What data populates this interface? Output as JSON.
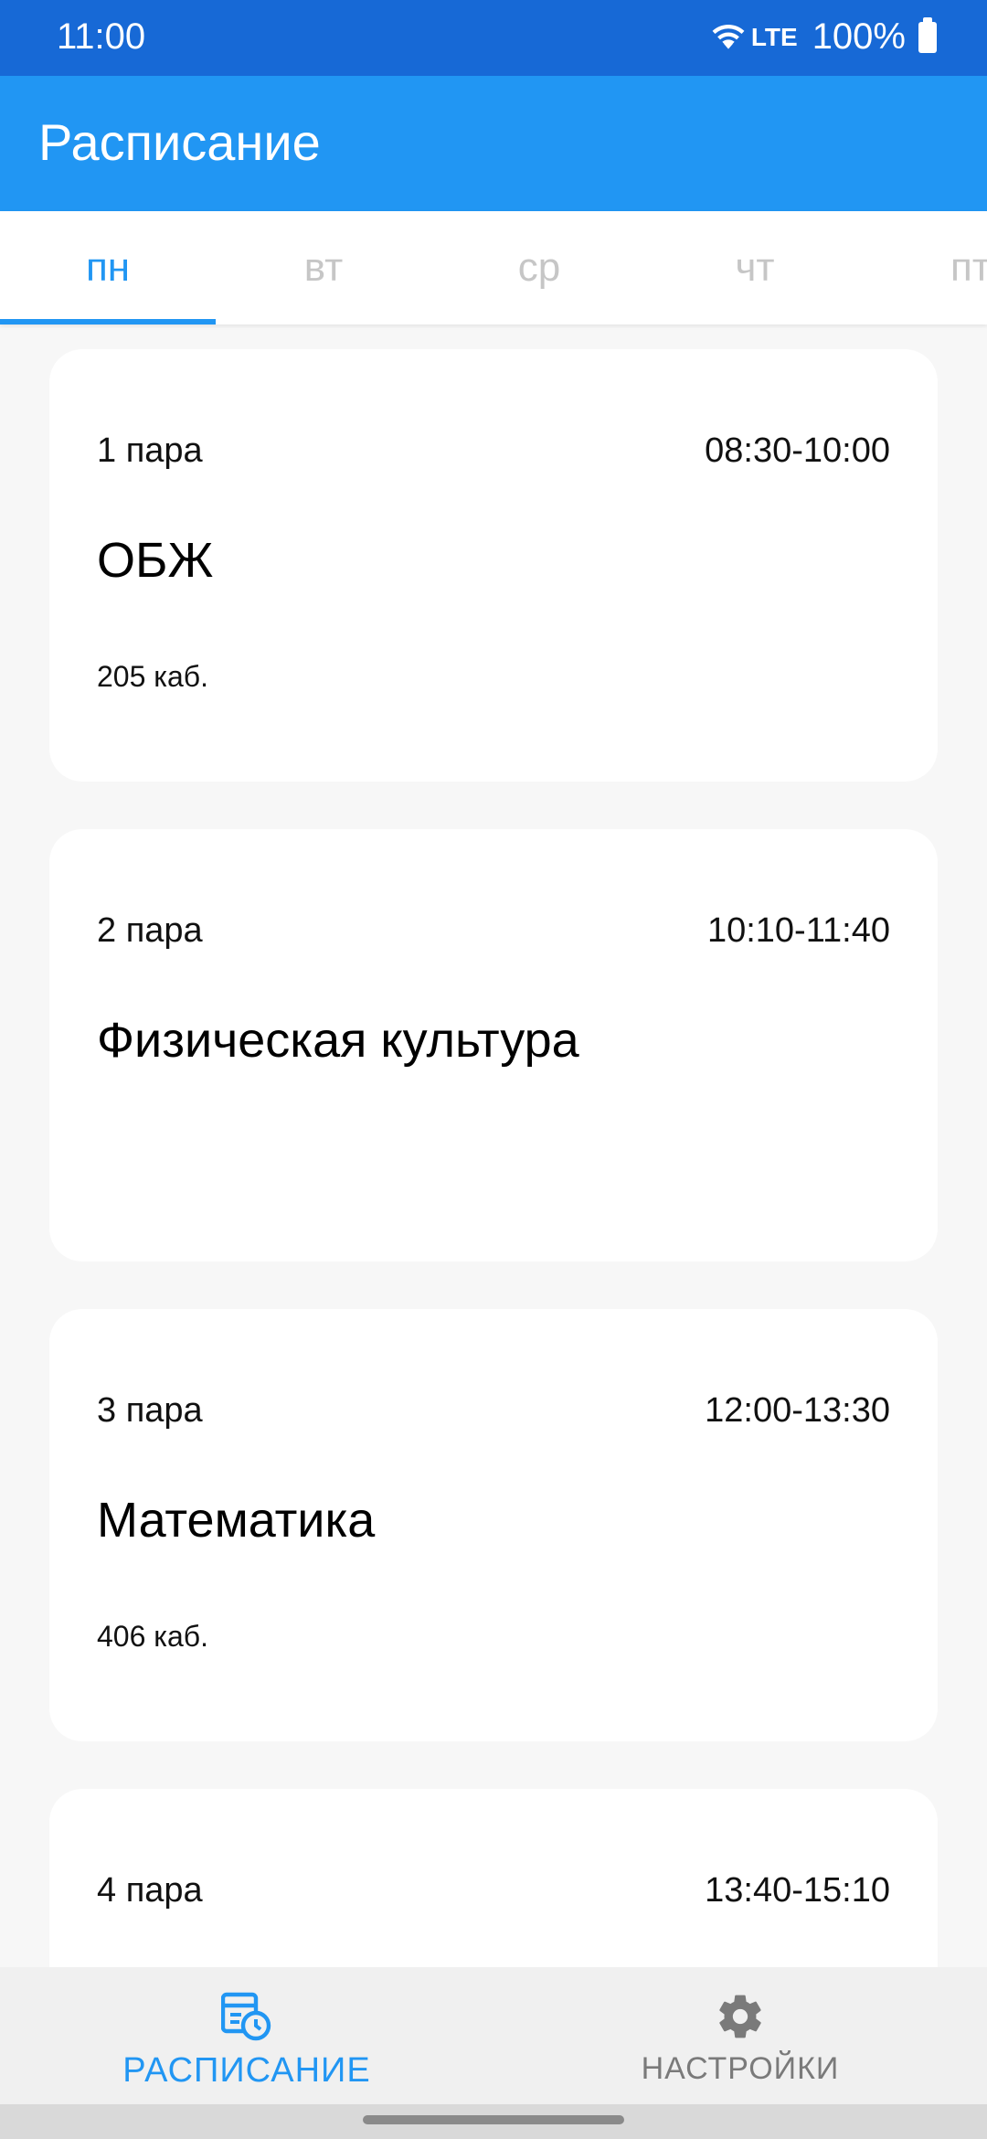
{
  "status_bar": {
    "time": "11:00",
    "network": "LTE",
    "battery": "100%",
    "icons": [
      "wifi-icon",
      "battery-icon"
    ]
  },
  "app_bar": {
    "title": "Расписание"
  },
  "tabs": [
    {
      "label": "пн",
      "active": true
    },
    {
      "label": "вт",
      "active": false
    },
    {
      "label": "ср",
      "active": false
    },
    {
      "label": "чт",
      "active": false
    },
    {
      "label": "пт",
      "active": false
    }
  ],
  "lessons": [
    {
      "pair": "1 пара",
      "time": "08:30-10:00",
      "subject": "ОБЖ",
      "room": "205 каб."
    },
    {
      "pair": "2 пара",
      "time": "10:10-11:40",
      "subject": "Физическая культура",
      "room": ""
    },
    {
      "pair": "3 пара",
      "time": "12:00-13:30",
      "subject": "Математика",
      "room": "406 каб."
    },
    {
      "pair": "4 пара",
      "time": "13:40-15:10",
      "subject": "",
      "room": ""
    }
  ],
  "bottom_nav": {
    "schedule": {
      "label": "РАСПИСАНИЕ",
      "icon": "schedule-icon",
      "active": true
    },
    "settings": {
      "label": "НАСТРОЙКИ",
      "icon": "gear-icon",
      "active": false
    }
  },
  "colors": {
    "status_bar": "#1769d6",
    "app_bar": "#2196f3",
    "accent": "#2196f3",
    "tab_inactive": "#c6c6c6",
    "background": "#f7f7f7",
    "card": "#ffffff"
  }
}
